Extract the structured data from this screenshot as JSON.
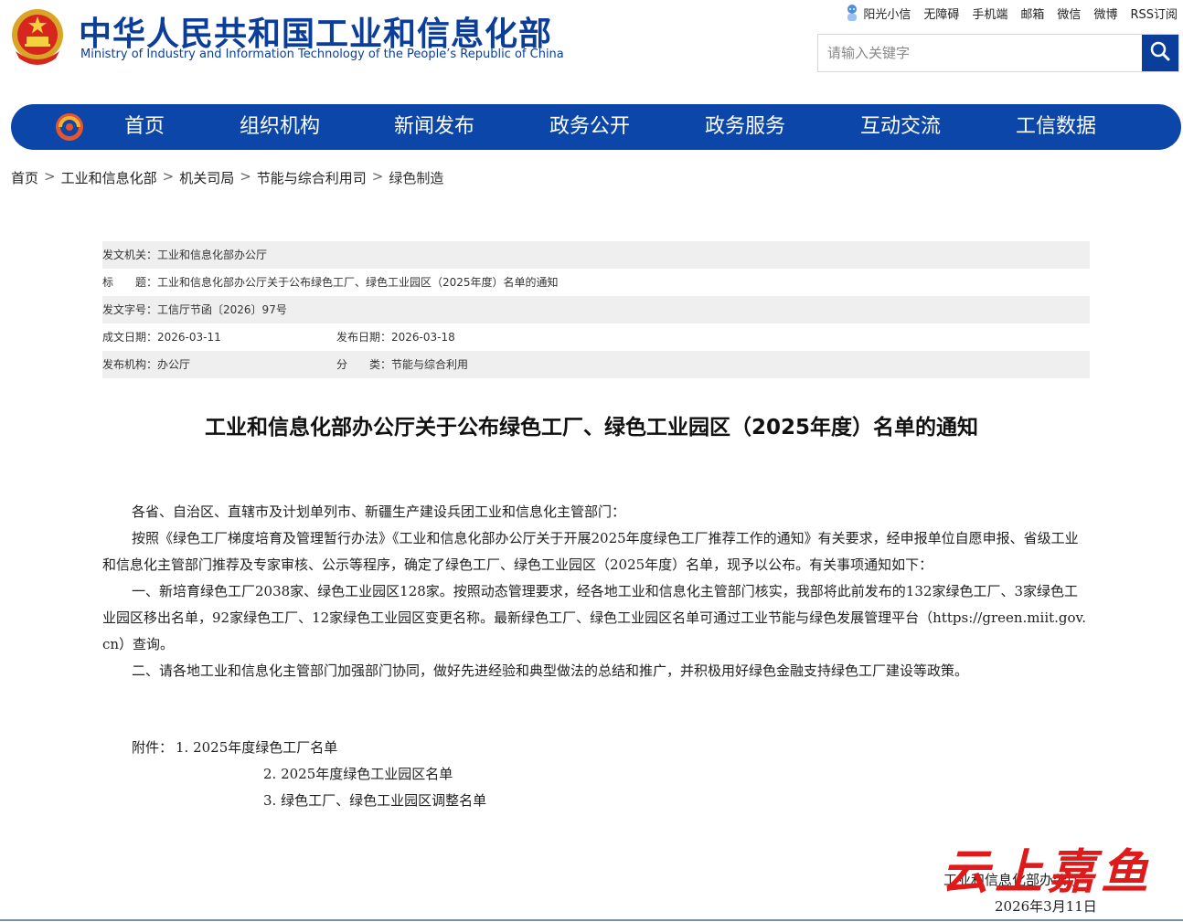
{
  "header": {
    "title": "中华人民共和国工业和信息化部",
    "subtitle": "Ministry of Industry and Information Technology of the People’s Republic of China",
    "top_links": [
      "阳光小信",
      "无障碍",
      "手机端",
      "邮箱",
      "微信",
      "微博",
      "RSS订阅"
    ],
    "search_placeholder": "请输入关键字",
    "colors": {
      "brand_blue": "#0b46a8",
      "title_blue": "#0b3e9a"
    }
  },
  "nav": {
    "items": [
      "首页",
      "组织机构",
      "新闻发布",
      "政务公开",
      "政务服务",
      "互动交流",
      "工信数据"
    ]
  },
  "breadcrumb": [
    "首页",
    "工业和信息化部",
    "机关司局",
    "节能与综合利用司",
    "绿色制造"
  ],
  "meta": {
    "issuer_label": "发文机关：",
    "issuer": "工业和信息化部办公厅",
    "subject_label": "标　　题：",
    "subject": "工业和信息化部办公厅关于公布绿色工厂、绿色工业园区（2025年度）名单的通知",
    "doc_no_label": "发文字号：",
    "doc_no": "工信厅节函〔2026〕97号",
    "written_label": "成文日期：",
    "written": "2026-03-11",
    "published_label": "发布日期：",
    "published": "2026-03-18",
    "agency_label": "发布机构：",
    "agency": "办公厅",
    "category_label": "分　　类：",
    "category": "节能与综合利用"
  },
  "document": {
    "title": "工业和信息化部办公厅关于公布绿色工厂、绿色工业园区（2025年度）名单的通知",
    "salutation": "各省、自治区、直辖市及计划单列市、新疆生产建设兵团工业和信息化主管部门：",
    "paragraph1": "按照《绿色工厂梯度培育及管理暂行办法》《工业和信息化部办公厅关于开展2025年度绿色工厂推荐工作的通知》有关要求，经申报单位自愿申报、省级工业和信息化主管部门推荐及专家审核、公示等程序，确定了绿色工厂、绿色工业园区（2025年度）名单，现予以公布。有关事项通知如下：",
    "paragraph2": "一、新培育绿色工厂2038家、绿色工业园区128家。按照动态管理要求，经各地工业和信息化主管部门核实，我部将此前发布的132家绿色工厂、3家绿色工业园区移出名单，92家绿色工厂、12家绿色工业园区变更名称。最新绿色工厂、绿色工业园区名单可通过工业节能与绿色发展管理平台（https://green.miit.gov.cn）查询。",
    "paragraph3": "二、请各地工业和信息化主管部门加强部门协同，做好先进经验和典型做法的总结和推广，并积极用好绿色金融支持绿色工厂建设等政策。",
    "attachments_label": "附件：",
    "attachments": [
      "1. 2025年度绿色工厂名单",
      "2. 2025年度绿色工业园区名单",
      "3. 绿色工厂、绿色工业园区调整名单"
    ],
    "signature": "工业和信息化部办公厅",
    "date": "2026年3月11日"
  },
  "watermark": "云上嘉鱼"
}
